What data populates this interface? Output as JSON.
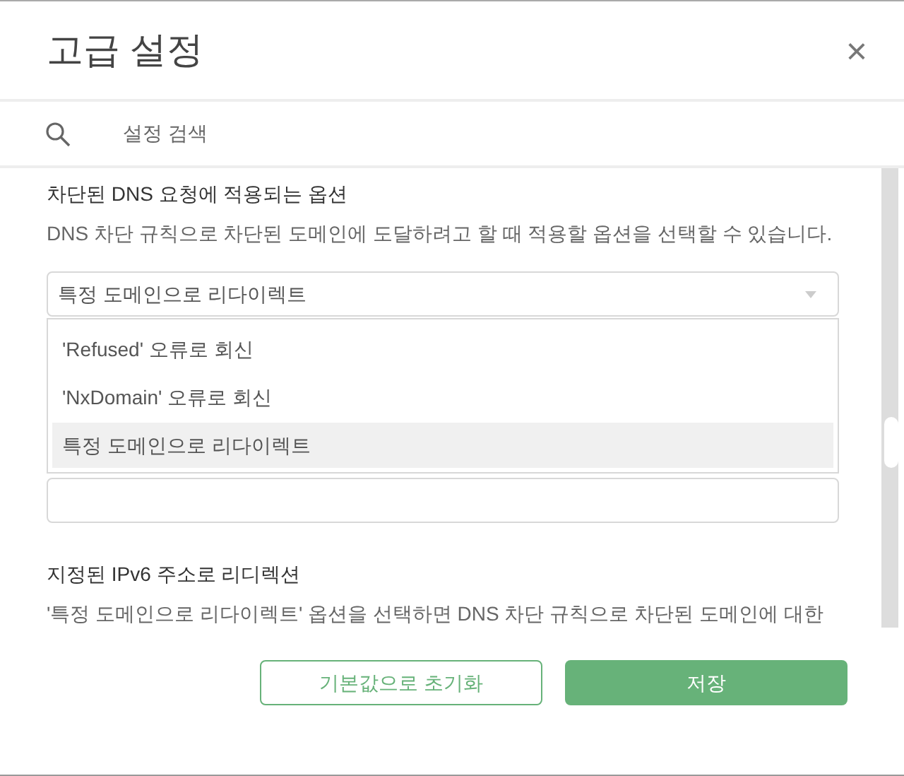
{
  "dialog": {
    "title": "고급 설정",
    "close": "×"
  },
  "search": {
    "placeholder": "설정 검색"
  },
  "sections": [
    {
      "title": "차단된 DNS 요청에 적용되는 옵션",
      "description": "DNS 차단 규칙으로 차단된 도메인에 도달하려고 할 때 적용할 옵션을 선택할 수 있습니다.",
      "select": {
        "value": "특정 도메인으로 리다이렉트",
        "expanded": true,
        "options": [
          {
            "label": "'Refused' 오류로 회신",
            "selected": false
          },
          {
            "label": "'NxDomain' 오류로 회신",
            "selected": false
          },
          {
            "label": "특정 도메인으로 리다이렉트",
            "selected": true
          }
        ]
      }
    },
    {
      "title": "지정된 IPv6 주소로 리디렉션",
      "description": "'특정 도메인으로 리다이렉트' 옵션을 선택하면 DNS 차단 규칙으로 차단된 도메인에 대한"
    }
  ],
  "buttons": [
    {
      "label": "기본값으로 초기화",
      "kind": "outline"
    },
    {
      "label": "저장",
      "kind": "primary"
    }
  ]
}
